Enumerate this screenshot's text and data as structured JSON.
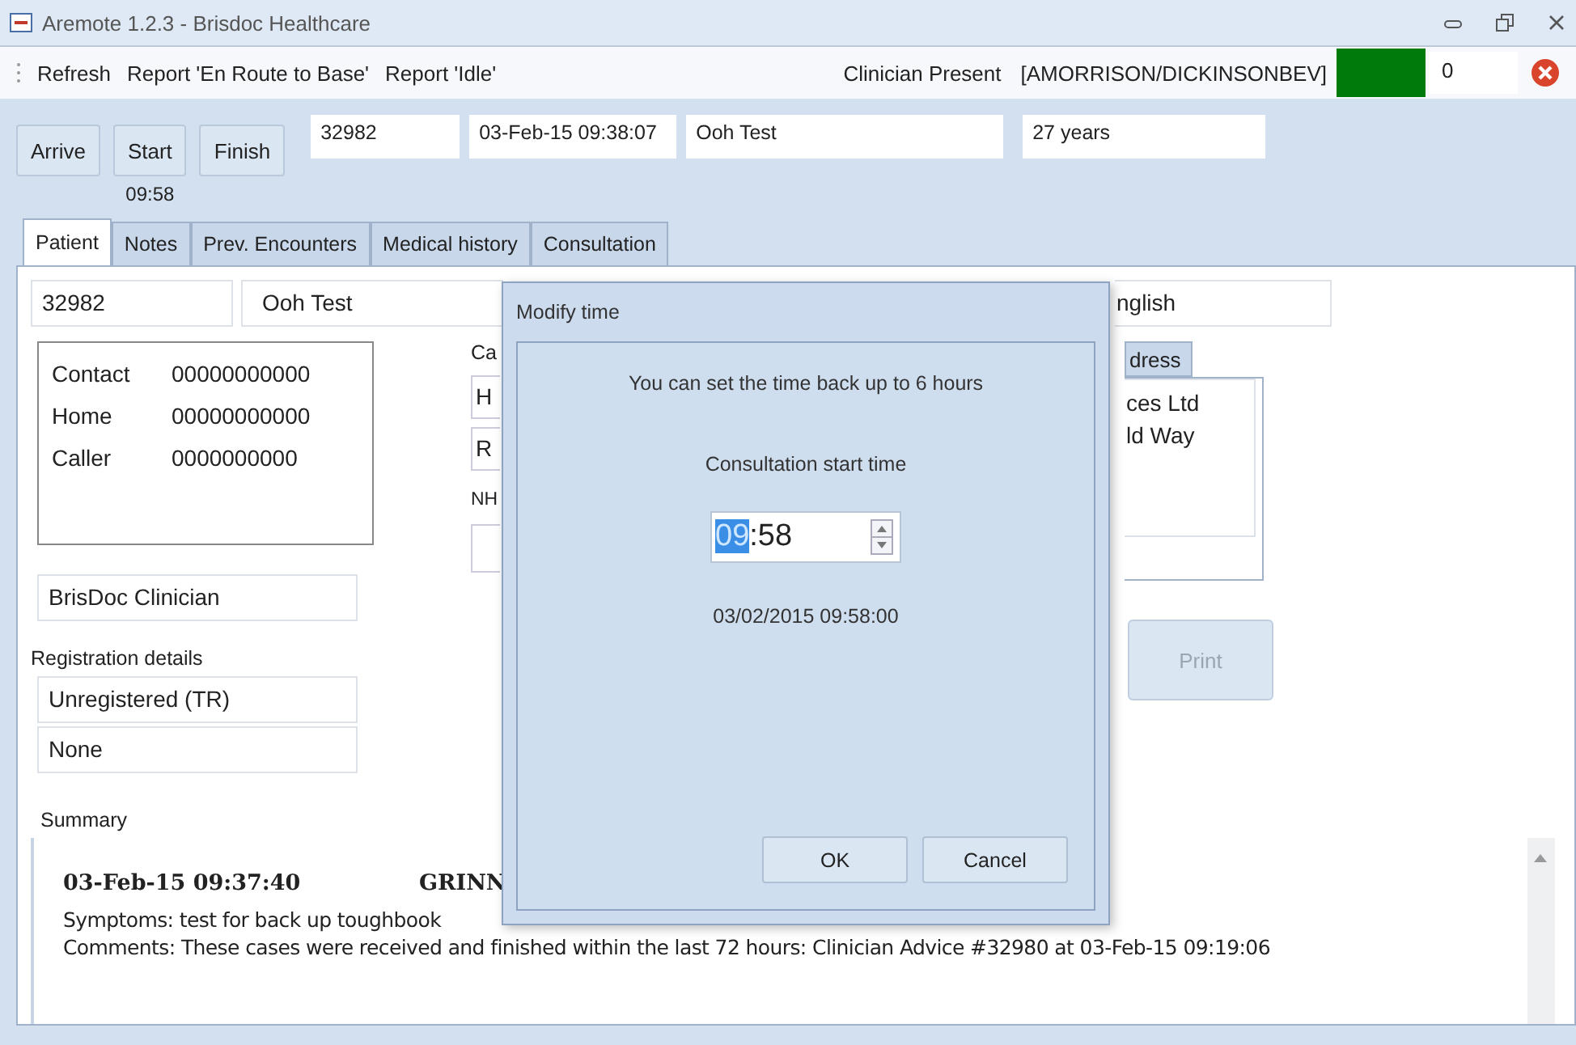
{
  "window": {
    "title": "Aremote 1.2.3 - Brisdoc Healthcare"
  },
  "toolbar": {
    "items": [
      "Refresh",
      "Report 'En Route to Base'",
      "Report 'Idle'"
    ],
    "status_label": "Clinician Present",
    "clinician": "[AMORRISON/DICKINSONBEV]",
    "counter": "0"
  },
  "actions": [
    {
      "label": "Arrive"
    },
    {
      "label": "Start",
      "time": "09:58"
    },
    {
      "label": "Finish"
    }
  ],
  "header_fields": [
    "32982",
    "03-Feb-15 09:38:07",
    "Ooh Test",
    "27 years"
  ],
  "tabs": [
    {
      "label": "Patient",
      "selected": true
    },
    {
      "label": "Notes",
      "selected": false
    },
    {
      "label": "Prev. Encounters",
      "selected": false
    },
    {
      "label": "Medical history",
      "selected": false
    },
    {
      "label": "Consultation",
      "selected": false
    }
  ],
  "patient": {
    "id": "32982",
    "name": "Ooh Test",
    "language": "nglish",
    "contacts": [
      {
        "label": "Contact",
        "number": "00000000000"
      },
      {
        "label": "Home",
        "number": "00000000000"
      },
      {
        "label": "Caller",
        "number": "0000000000"
      }
    ],
    "middle_label": "Ca",
    "middle_fields": [
      "H",
      "R"
    ],
    "nhs_label": "NH",
    "address_tab": "dress",
    "address_lines": [
      "ces Ltd",
      "ld Way"
    ],
    "clinician": "BrisDoc Clinician",
    "registration_label": "Registration details",
    "registration": [
      "Unregistered (TR)",
      "None"
    ],
    "print": {
      "label": "Print",
      "disabled": true
    }
  },
  "summary": {
    "label": "Summary",
    "timestamp": "03-Feb-15 09:37:40",
    "author": "GRINN",
    "lines": [
      "Symptoms: test for back up toughbook",
      "Comments: These cases were received and finished within the last 72 hours: Clinician Advice #32980 at 03-Feb-15 09:19:06"
    ]
  },
  "dialog": {
    "title": "Modify time",
    "message": "You can set the time back up to 6 hours",
    "label": "Consultation start time",
    "time_selected": "09",
    "time_rest": ":58",
    "result": "03/02/2015 09:58:00",
    "buttons": [
      "OK",
      "Cancel"
    ]
  }
}
